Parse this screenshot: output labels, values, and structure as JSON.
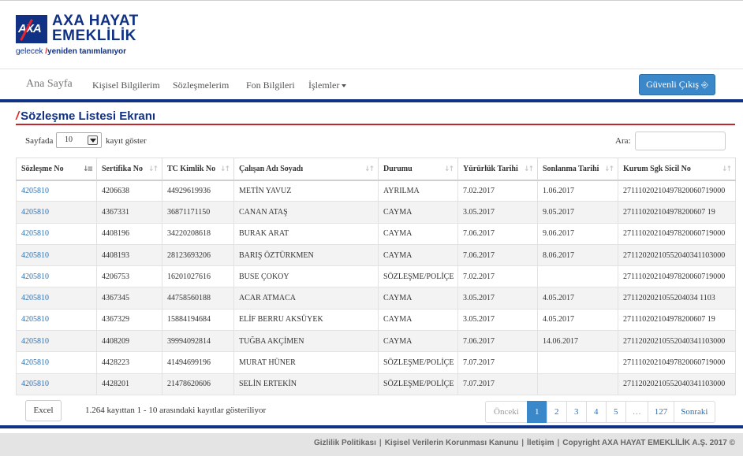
{
  "brand": {
    "axa": "AXA",
    "line1": "AXA HAYAT",
    "line2": "EMEKLİLİK",
    "tag_pre": "gelecek",
    "tag_mark": "/",
    "tag_post": "yeniden tanımlanıyor"
  },
  "nav": {
    "items": [
      "Ana Sayfa",
      "Kişisel Bilgilerim",
      "Sözleşmelerim",
      "Fon Bilgileri",
      "İşlemler"
    ],
    "logout": "Güvenli Çıkış",
    "logout_icon": "sign-out-icon"
  },
  "page": {
    "title_mark": "/",
    "title": "Sözleşme Listesi Ekranı"
  },
  "controls": {
    "length_prefix": "Sayfada",
    "length_value": "10",
    "length_suffix": "kayıt göster",
    "search_label": "Ara:",
    "search_value": ""
  },
  "table": {
    "columns": [
      "Sözleşme No",
      "Sertifika No",
      "TC Kimlik No",
      "Çalışan Adı Soyadı",
      "Durumu",
      "Yürürlük Tarihi",
      "Sonlanma Tarihi",
      "Kurum Sgk Sicil No"
    ],
    "rows": [
      [
        "4205810",
        "4206638",
        "44929619936",
        "METİN YAVUZ",
        "AYRILMA",
        "7.02.2017",
        "1.06.2017",
        "27111020210497820060719000"
      ],
      [
        "4205810",
        "4367331",
        "36871171150",
        "CANAN ATAŞ",
        "CAYMA",
        "3.05.2017",
        "9.05.2017",
        "271110202104978200607 19"
      ],
      [
        "4205810",
        "4408196",
        "34220208618",
        "BURAK ARAT",
        "CAYMA",
        "7.06.2017",
        "9.06.2017",
        "27111020210497820060719000"
      ],
      [
        "4205810",
        "4408193",
        "28123693206",
        "BARIŞ ÖZTÜRKMEN",
        "CAYMA",
        "7.06.2017",
        "8.06.2017",
        "27112020210552040341103000"
      ],
      [
        "4205810",
        "4206753",
        "16201027616",
        "BUSE ÇOKOY",
        "SÖZLEŞME/POLİÇE",
        "7.02.2017",
        "",
        "27111020210497820060719000"
      ],
      [
        "4205810",
        "4367345",
        "44758560188",
        "ACAR ATMACA",
        "CAYMA",
        "3.05.2017",
        "4.05.2017",
        "2711202021055204034 1103"
      ],
      [
        "4205810",
        "4367329",
        "15884194684",
        "ELİF BERRU AKSÜYEK",
        "CAYMA",
        "3.05.2017",
        "4.05.2017",
        "271110202104978200607 19"
      ],
      [
        "4205810",
        "4408209",
        "39994092814",
        "TUĞBA AKÇİMEN",
        "CAYMA",
        "7.06.2017",
        "14.06.2017",
        "27112020210552040341103000"
      ],
      [
        "4205810",
        "4428223",
        "41494699196",
        "MURAT HÜNER",
        "SÖZLEŞME/POLİÇE",
        "7.07.2017",
        "",
        "27111020210497820060719000"
      ],
      [
        "4205810",
        "4428201",
        "21478620606",
        "SELİN ERTEKİN",
        "SÖZLEŞME/POLİÇE",
        "7.07.2017",
        "",
        "27112020210552040341103000"
      ]
    ]
  },
  "footer_controls": {
    "excel": "Excel",
    "info": "1.264 kayıttan 1 - 10 arasındaki kayıtlar gösteriliyor",
    "pagination": [
      "Önceki",
      "1",
      "2",
      "3",
      "4",
      "5",
      "…",
      "127",
      "Sonraki"
    ],
    "active_page": "1"
  },
  "site_footer": {
    "links": [
      "Gizlilik Politikası",
      "Kişisel Verilerin Korunması Kanunu",
      "İletişim",
      "Copyright AXA HAYAT EMEKLİLİK A.Ş. 2017 ©"
    ]
  },
  "colors": {
    "brand_navy": "#103184",
    "brand_red": "#e4262c",
    "primary_button": "#3a87c9",
    "link": "#2f6fb0"
  }
}
